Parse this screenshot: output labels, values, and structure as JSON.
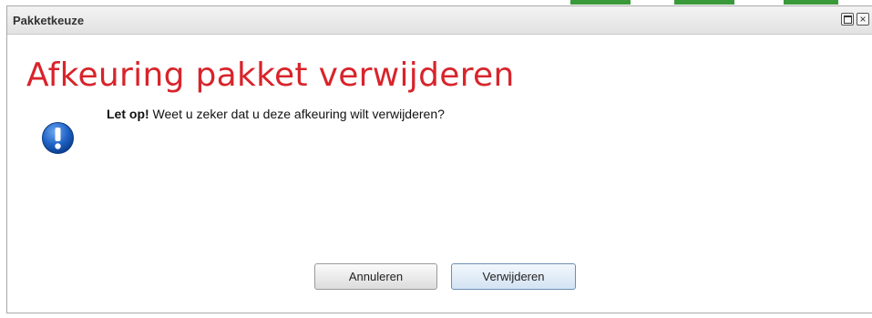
{
  "dialog": {
    "title": "Pakketkeuze",
    "heading": "Afkeuring pakket verwijderen",
    "message_strong": "Let op!",
    "message_text": " Weet u zeker dat u deze afkeuring wilt verwijderen?",
    "close_glyph": "×"
  },
  "buttons": {
    "cancel_label": "Annuleren",
    "delete_label": "Verwijderen"
  },
  "colors": {
    "heading": "#d8242b",
    "icon": "#1f63c6"
  },
  "icons": {
    "info": "exclamation-icon",
    "maximize": "maximize-icon",
    "close": "close-icon"
  }
}
